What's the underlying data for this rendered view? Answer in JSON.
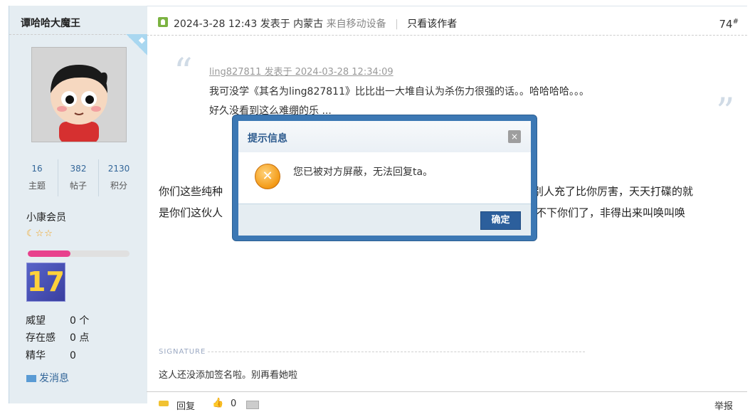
{
  "user": {
    "name": "谭哈哈大魔王",
    "stats": [
      {
        "value": "16",
        "label": "主题"
      },
      {
        "value": "382",
        "label": "帖子"
      },
      {
        "value": "2130",
        "label": "积分"
      }
    ],
    "group": "小康会员",
    "level_progress": 0.42,
    "medal_text": "17",
    "attributes": [
      {
        "key": "威望",
        "value": "0 个"
      },
      {
        "key": "存在感",
        "value": "0 点"
      },
      {
        "key": "精华",
        "value": "0"
      }
    ],
    "send_message": "发消息"
  },
  "post": {
    "meta": "2024-3-28 12:43 发表于 内蒙古",
    "device": "来自移动设备",
    "author_only": "只看该作者",
    "floor": "74",
    "floor_mark": "#",
    "quote": {
      "meta": "ling827811 发表于 2024-03-28 12:34:09",
      "line1": "我可没学《其名为ling827811》比比出一大堆自认为杀伤力很强的话。。哈哈哈哈。。。",
      "line2": "好久没看到这么难绷的乐 ..."
    },
    "body": {
      "line1_left": "你们这些纯种",
      "line1_right": "怕别人充了比你厉害，天天打碟的就",
      "line2_left": "是你们这伙人",
      "line2_right": "容不下你们了，非得出来叫唤叫唤"
    },
    "signature_label": "SIGNATURE",
    "signature": "这人还没添加签名啦。别再看她啦",
    "footer": {
      "reply": "回复",
      "like_count": "0",
      "report": "举报"
    }
  },
  "dialog": {
    "title": "提示信息",
    "close": "×",
    "icon_symbol": "✕",
    "message": "您已被对方屏蔽，无法回复ta。",
    "ok": "确定"
  }
}
